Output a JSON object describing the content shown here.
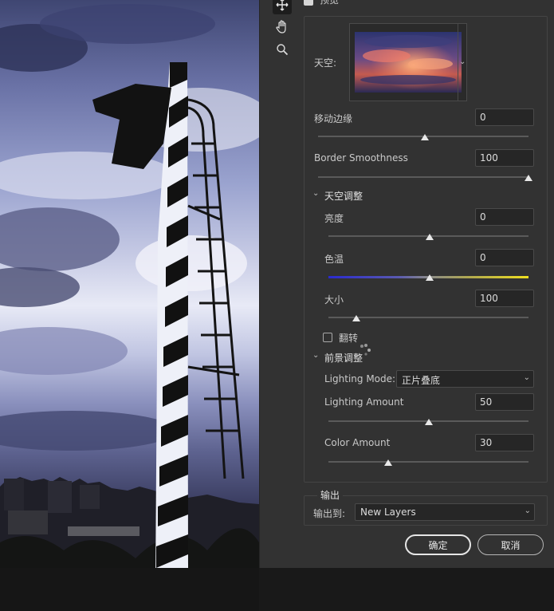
{
  "preview": {
    "label": "预览"
  },
  "sky": {
    "label": "天空:",
    "shift_edge": {
      "label": "移动边缘",
      "value": "0",
      "slider": 0.5
    },
    "border_smoothness": {
      "label": "Border Smoothness",
      "value": "100",
      "slider": 1.0
    }
  },
  "sky_adjust": {
    "title": "天空调整",
    "brightness": {
      "label": "亮度",
      "value": "0",
      "slider": 0.5
    },
    "temperature": {
      "label": "色温",
      "value": "0",
      "slider": 0.5
    },
    "scale": {
      "label": "大小",
      "value": "100",
      "slider": 0.14
    },
    "flip": {
      "label": "翻转",
      "checked": false
    }
  },
  "foreground_adjust": {
    "title": "前景调整",
    "lighting_mode": {
      "label": "Lighting Mode:",
      "value": "正片叠底"
    },
    "lighting_amount": {
      "label": "Lighting Amount",
      "value": "50",
      "slider": 0.5
    },
    "color_amount": {
      "label": "Color Amount",
      "value": "30",
      "slider": 0.3
    }
  },
  "output": {
    "title": "输出",
    "label": "输出到:",
    "value": "New Layers"
  },
  "buttons": {
    "ok": "确定",
    "cancel": "取消"
  },
  "colors": {
    "dialog_bg": "#323232",
    "field_bg": "#262626",
    "temp_cool": "#2a2ad0",
    "temp_warm": "#f0e020"
  }
}
